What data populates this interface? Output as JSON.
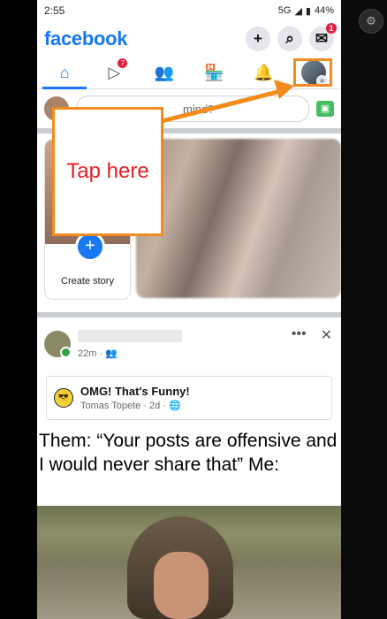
{
  "status": {
    "time": "2:55",
    "battery": "44%",
    "signal": "5G"
  },
  "app": {
    "title": "facebook"
  },
  "top_icons": [
    "plus-icon",
    "search-icon",
    "messenger-icon"
  ],
  "messenger_badge": "1",
  "tabs": [
    {
      "name": "home-icon",
      "badge": ""
    },
    {
      "name": "video-icon",
      "badge": "7"
    },
    {
      "name": "friends-icon",
      "badge": ""
    },
    {
      "name": "marketplace-icon",
      "badge": ""
    },
    {
      "name": "bell-icon",
      "badge": ""
    },
    {
      "name": "profile-menu-icon",
      "badge": ""
    }
  ],
  "composer": {
    "placeholder": "mind?"
  },
  "stories": {
    "create_label": "Create story"
  },
  "post": {
    "time": "22m",
    "shared_title": "OMG! That's Funny!",
    "shared_meta": "Tomas Topete · 2d ·",
    "text": "Them: “Your posts are offensive and I would never share that” Me:"
  },
  "annotation": {
    "label": "Tap here",
    "color": "#F28C1E",
    "text_color": "#e21f24"
  }
}
